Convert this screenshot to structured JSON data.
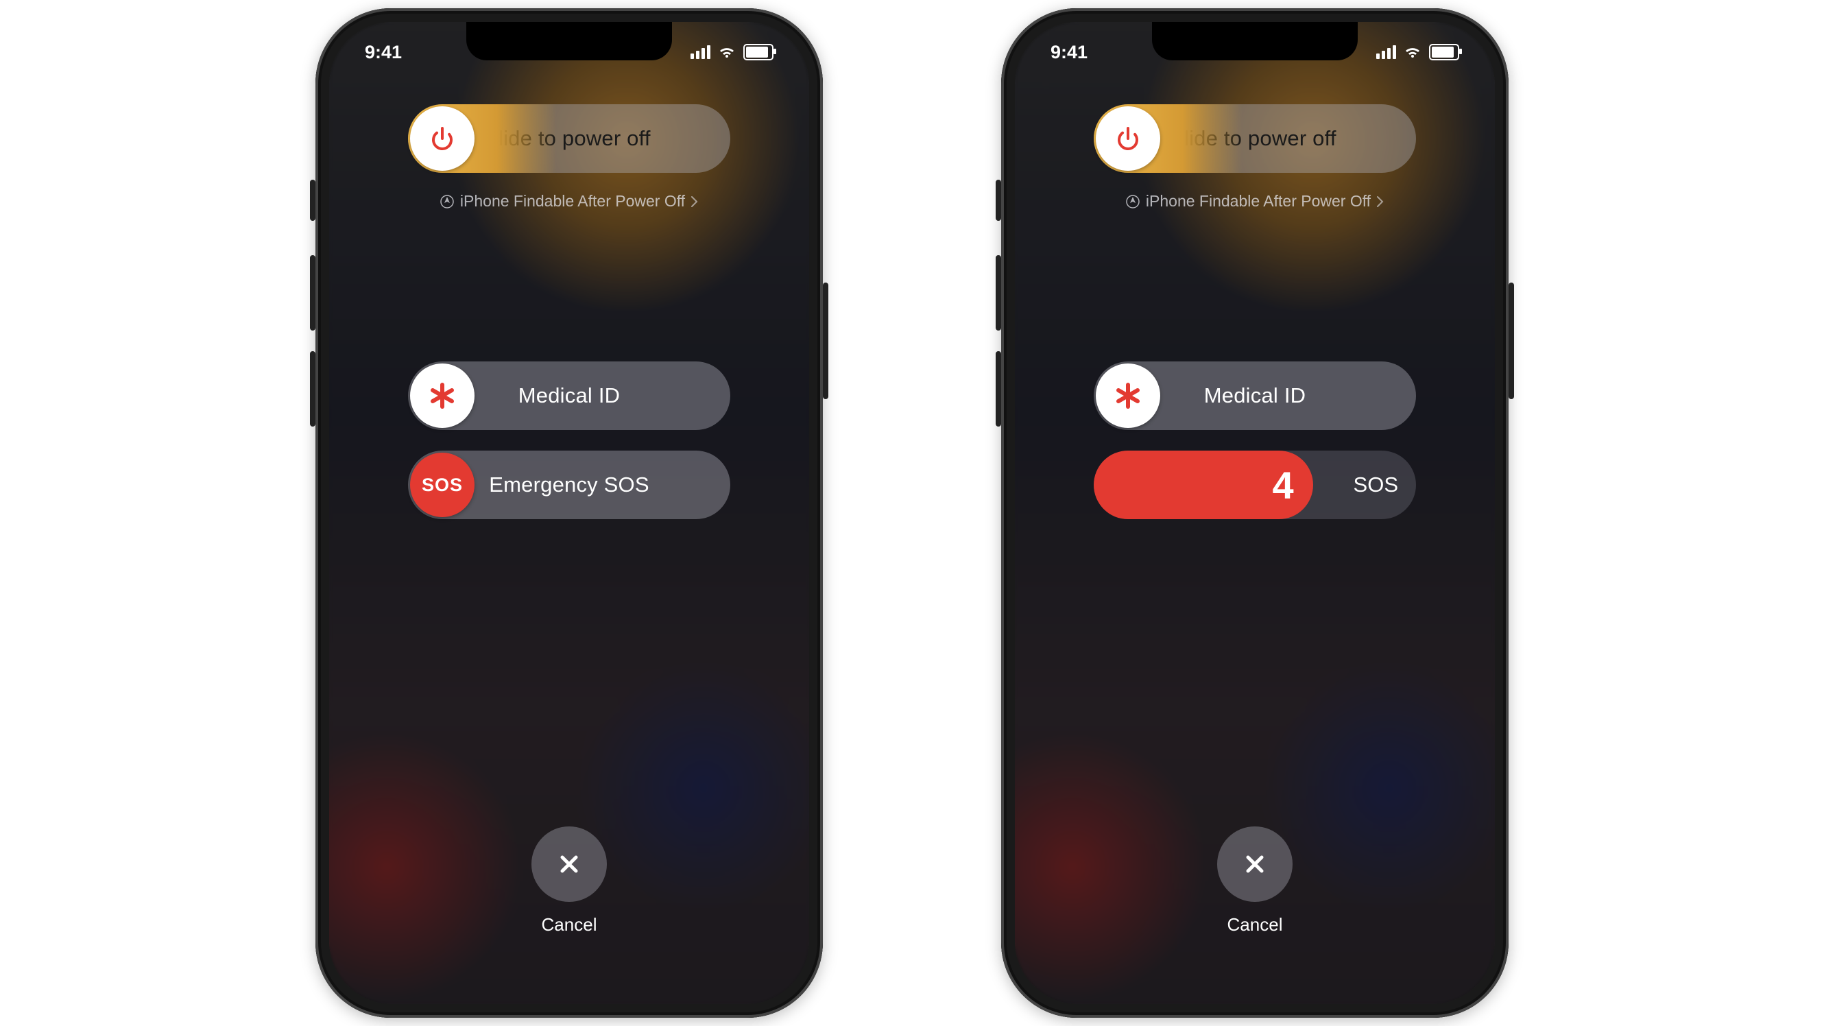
{
  "status": {
    "time": "9:41"
  },
  "power_slider": {
    "label": "slide to power off"
  },
  "findable": {
    "text": "iPhone Findable After Power Off"
  },
  "medical_slider": {
    "label": "Medical ID"
  },
  "sos_slider": {
    "label": "Emergency SOS",
    "knob": "SOS"
  },
  "sos_countdown": {
    "number": "4",
    "stub": "SOS"
  },
  "cancel": {
    "label": "Cancel"
  }
}
